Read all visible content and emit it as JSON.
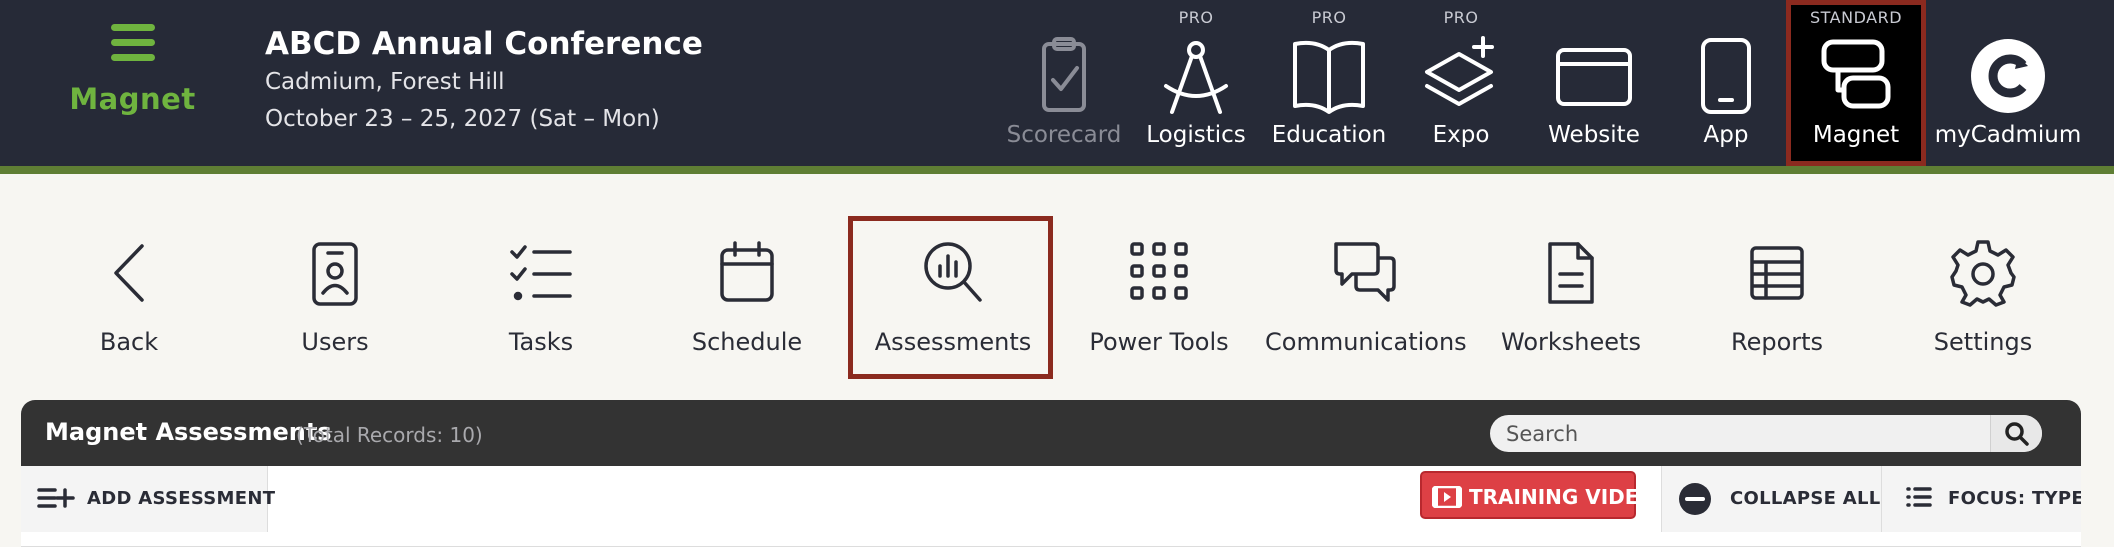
{
  "brand": {
    "name": "Magnet",
    "color": "#6fb43f"
  },
  "event": {
    "title": "ABCD Annual Conference",
    "location": "Cadmium, Forest Hill",
    "dates": "October 23 – 25, 2027 (Sat – Mon)"
  },
  "apps": [
    {
      "tier": "",
      "label": "Scorecard",
      "icon": "clipboard-check-icon",
      "state": "disabled"
    },
    {
      "tier": "PRO",
      "label": "Logistics",
      "icon": "compass-icon",
      "state": "normal"
    },
    {
      "tier": "PRO",
      "label": "Education",
      "icon": "book-icon",
      "state": "normal"
    },
    {
      "tier": "PRO",
      "label": "Expo",
      "icon": "layers-plus-icon",
      "state": "normal"
    },
    {
      "tier": "",
      "label": "Website",
      "icon": "browser-window-icon",
      "state": "normal"
    },
    {
      "tier": "",
      "label": "App",
      "icon": "phone-icon",
      "state": "normal"
    },
    {
      "tier": "STANDARD",
      "label": "Magnet",
      "icon": "magnet-app-icon",
      "state": "selected"
    },
    {
      "tier": "",
      "label": "myCadmium",
      "icon": "cadmium-logo-icon",
      "state": "normal"
    }
  ],
  "modules": [
    {
      "label": "Back",
      "icon": "chevron-left-icon"
    },
    {
      "label": "Users",
      "icon": "id-badge-icon"
    },
    {
      "label": "Tasks",
      "icon": "checklist-icon"
    },
    {
      "label": "Schedule",
      "icon": "calendar-icon"
    },
    {
      "label": "Assessments",
      "icon": "magnifier-chart-icon",
      "selected": true
    },
    {
      "label": "Power Tools",
      "icon": "grid-dots-icon"
    },
    {
      "label": "Communications",
      "icon": "chat-bubbles-icon"
    },
    {
      "label": "Worksheets",
      "icon": "document-icon"
    },
    {
      "label": "Reports",
      "icon": "table-icon"
    },
    {
      "label": "Settings",
      "icon": "gear-icon"
    }
  ],
  "panel": {
    "title": "Magnet Assessments",
    "count": "(Total Records: 10)",
    "search_placeholder": "Search"
  },
  "toolbar": {
    "add": "ADD ASSESSMENT",
    "training": "TRAINING VIDEO",
    "collapse": "COLLAPSE ALL",
    "focus": "FOCUS: TYPE"
  },
  "colors": {
    "header_bg": "#262a37",
    "accent_stripe": "#5f7e34",
    "selected_border": "#8b2a1f",
    "training_button": "#dd4045"
  }
}
